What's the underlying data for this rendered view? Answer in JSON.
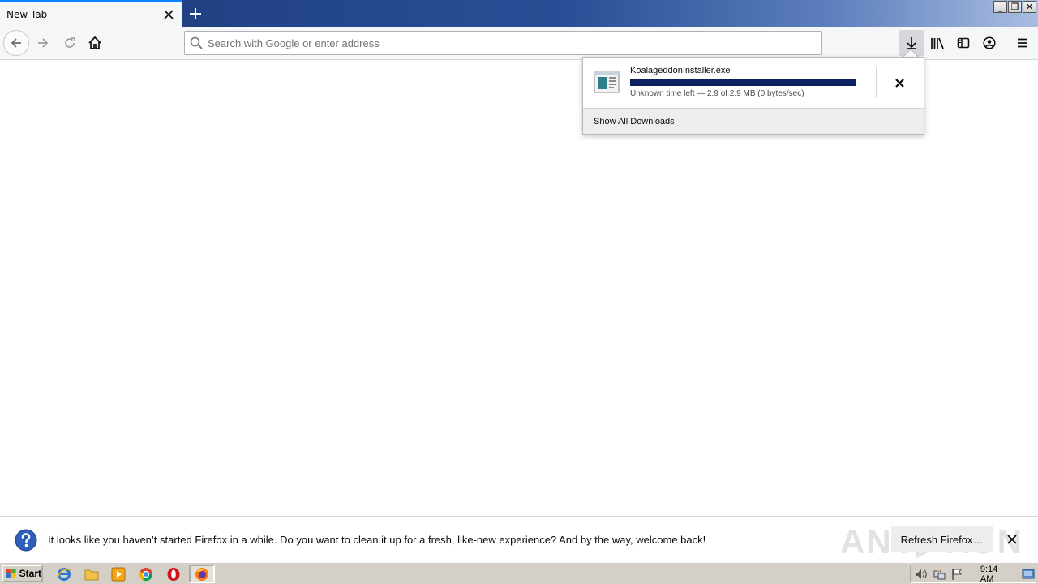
{
  "tab": {
    "title": "New Tab"
  },
  "window": {
    "minimize": "_",
    "restore": "❐",
    "close": "✕"
  },
  "urlbar": {
    "placeholder": "Search with Google or enter address"
  },
  "downloads": {
    "item": {
      "filename": "KoalageddonInstaller.exe",
      "status": "Unknown time left — 2.9 of 2.9 MB (0 bytes/sec)",
      "progress_percent": 100
    },
    "footer_label": "Show All Downloads"
  },
  "notification": {
    "message": "It looks like you haven’t started Firefox in a while. Do you want to clean it up for a fresh, like-new experience? And by the way, welcome back!",
    "button_label": "Refresh Firefox…",
    "watermark": "ANY▷RUN"
  },
  "taskbar": {
    "start_label": "Start",
    "clock": "9:14 AM"
  },
  "colors": {
    "accent": "#0a84ff",
    "progress": "#0b2262",
    "titlebar": "#1d3a7c"
  }
}
